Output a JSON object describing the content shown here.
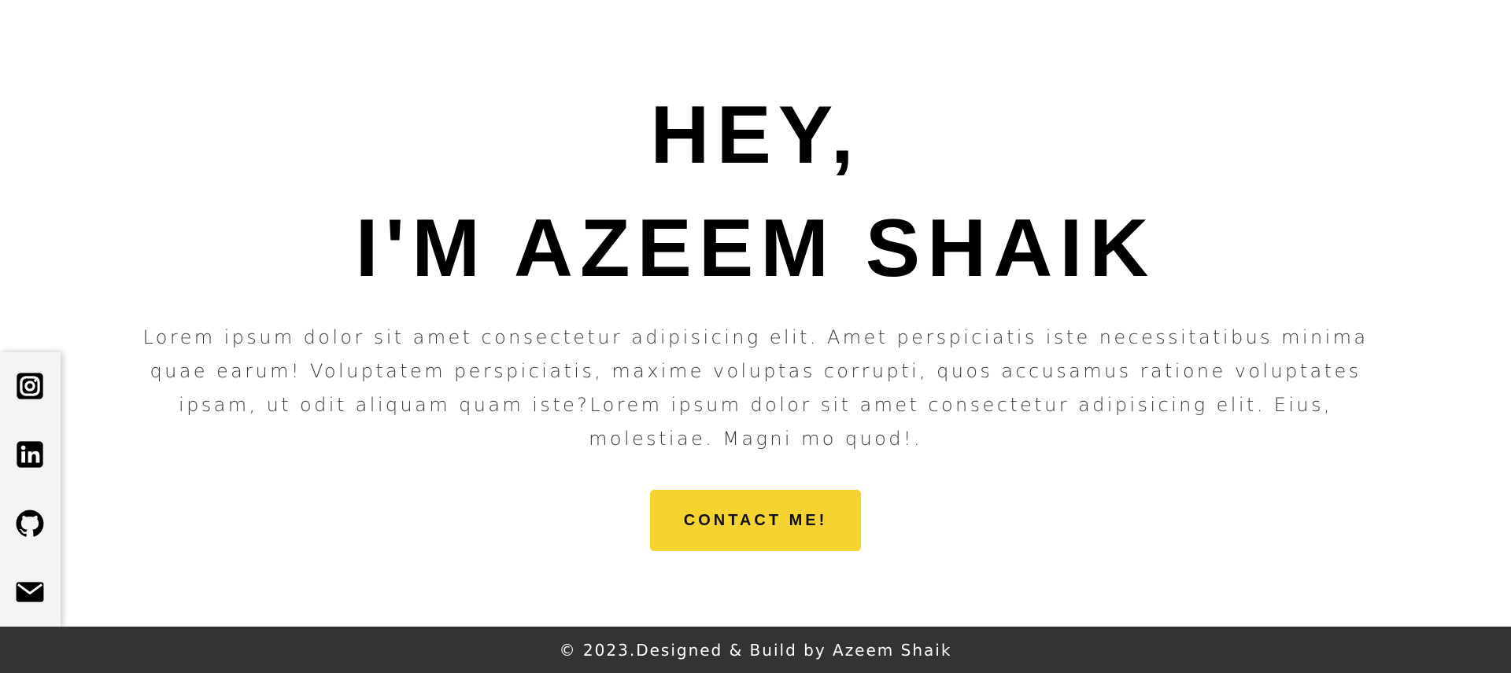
{
  "hero": {
    "greeting": "HEY,",
    "name_line": "I'M AZEEM SHAIK",
    "description": "Lorem ipsum dolor sit amet consectetur adipisicing elit. Amet perspiciatis iste necessitatibus minima quae earum! Voluptatem perspiciatis, maxime voluptas corrupti, quos accusamus ratione voluptates ipsam, ut odit aliquam quam iste?Lorem ipsum dolor sit amet consectetur adipisicing elit. Eius, molestiae. Magni mo quod!.",
    "contact_button": "CONTACT ME!"
  },
  "social": {
    "items": [
      {
        "icon": "instagram-icon"
      },
      {
        "icon": "linkedin-icon"
      },
      {
        "icon": "github-icon"
      },
      {
        "icon": "mail-icon"
      }
    ]
  },
  "footer": {
    "text": "© 2023.Designed & Build by Azeem Shaik"
  },
  "colors": {
    "accent": "#f5d432",
    "footer_bg": "#333333",
    "text": "#000000",
    "sidebar_bg": "#f4f4f4"
  }
}
